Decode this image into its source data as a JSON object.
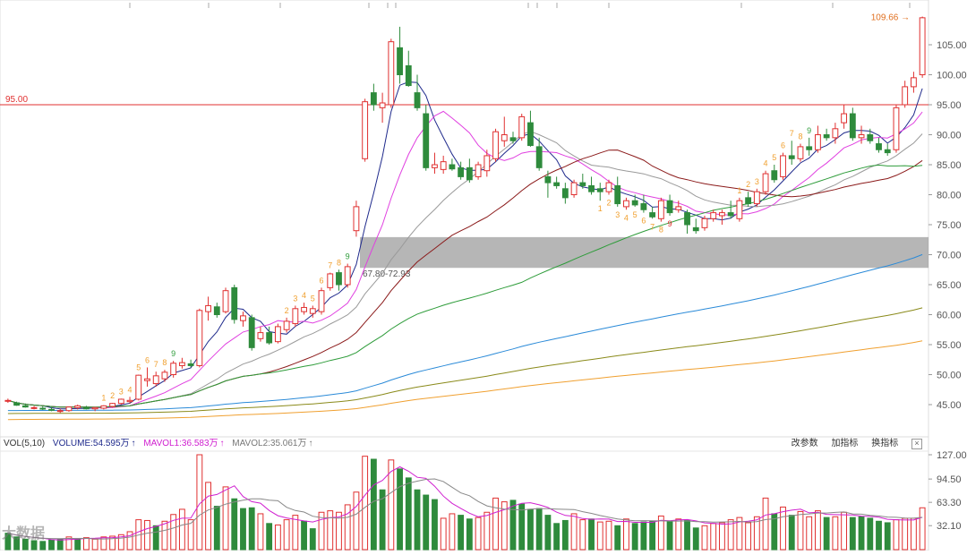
{
  "price_axis": {
    "ticks": [
      {
        "label": "105.00",
        "value": 105
      },
      {
        "label": "100.00",
        "value": 100
      },
      {
        "label": "95.00",
        "value": 95
      },
      {
        "label": "90.00",
        "value": 90
      },
      {
        "label": "85.00",
        "value": 85
      },
      {
        "label": "80.00",
        "value": 80
      },
      {
        "label": "75.00",
        "value": 75
      },
      {
        "label": "70.00",
        "value": 70
      },
      {
        "label": "65.00",
        "value": 65
      },
      {
        "label": "60.00",
        "value": 60
      },
      {
        "label": "55.00",
        "value": 55
      },
      {
        "label": "50.00",
        "value": 50
      },
      {
        "label": "45.00",
        "value": 45
      }
    ]
  },
  "volume_axis": {
    "ticks": [
      {
        "label": "127.00",
        "value": 127
      },
      {
        "label": "94.50",
        "value": 94.5
      },
      {
        "label": "63.30",
        "value": 63.3
      },
      {
        "label": "32.10",
        "value": 32.1
      }
    ]
  },
  "reference_line": {
    "label": "95.00",
    "value": 95,
    "color": "#e03030"
  },
  "max_label": "109.66",
  "zone": {
    "label": "67.80-72.93",
    "low": 67.8,
    "high": 72.93
  },
  "volume_header": {
    "title": "VOL(5,10)",
    "volume": "VOLUME:54.595万",
    "mavol1": "MAVOL1:36.583万",
    "mavol2": "MAVOL2:35.061万",
    "arrow": "↑",
    "btn_params": "改参数",
    "btn_add": "加指标",
    "btn_switch": "换指标",
    "btn_close": "×"
  },
  "watermark": "大数据",
  "colors": {
    "up": "#e03030",
    "down": "#2e8b3c",
    "ma5": "#1f2a8c",
    "ma10": "#e040e0",
    "ma20": "#9a9a9a",
    "ma30": "#8b1a1a",
    "ma60": "#2e9c3a",
    "ma120": "#2a8ad8",
    "ma180": "#8a8a1a",
    "ma250": "#f0a030",
    "td_sequence": "#f0a030",
    "td_sequence_9": "#2e9c3a"
  },
  "chart_data": {
    "type": "candlestick",
    "ylim": [
      43,
      111
    ],
    "candles": [
      [
        45.6,
        46.0,
        45.3,
        45.7
      ],
      [
        45.3,
        45.5,
        44.8,
        44.9
      ],
      [
        44.8,
        45.2,
        44.5,
        44.6
      ],
      [
        44.4,
        44.8,
        44.2,
        44.5
      ],
      [
        44.4,
        44.7,
        44.1,
        44.3
      ],
      [
        44.2,
        44.6,
        43.9,
        44.1
      ],
      [
        43.9,
        44.3,
        43.6,
        44.0
      ],
      [
        44.0,
        44.7,
        43.8,
        44.6
      ],
      [
        44.5,
        45.0,
        44.2,
        44.8
      ],
      [
        44.5,
        44.8,
        44.2,
        44.3
      ],
      [
        44.3,
        44.6,
        43.9,
        44.5
      ],
      [
        44.4,
        44.9,
        44.2,
        44.8
      ],
      [
        44.7,
        45.3,
        44.5,
        45.2
      ],
      [
        45.2,
        46.0,
        45.0,
        45.9
      ],
      [
        45.5,
        46.3,
        45.2,
        45.7
      ],
      [
        45.9,
        50.0,
        45.7,
        49.9
      ],
      [
        49.0,
        51.2,
        48.0,
        49.3
      ],
      [
        48.5,
        50.5,
        48.0,
        49.8
      ],
      [
        49.3,
        50.8,
        48.8,
        50.4
      ],
      [
        50.0,
        52.3,
        49.5,
        51.9
      ],
      [
        51.5,
        52.8,
        51.0,
        52.0
      ],
      [
        51.8,
        52.5,
        51.2,
        51.5
      ],
      [
        51.5,
        61.0,
        51.2,
        60.7
      ],
      [
        60.5,
        63.0,
        59.0,
        61.5
      ],
      [
        61.3,
        62.0,
        59.5,
        60.0
      ],
      [
        60.5,
        64.5,
        60.2,
        64.0
      ],
      [
        64.5,
        65.0,
        58.5,
        59.2
      ],
      [
        59.0,
        60.5,
        58.0,
        59.8
      ],
      [
        59.5,
        60.0,
        54.0,
        54.5
      ],
      [
        56.0,
        58.0,
        55.5,
        57.0
      ],
      [
        57.0,
        58.0,
        55.0,
        55.3
      ],
      [
        55.5,
        58.5,
        55.2,
        58.0
      ],
      [
        57.5,
        59.5,
        57.0,
        58.9
      ],
      [
        58.5,
        61.5,
        58.0,
        61.0
      ],
      [
        60.5,
        62.0,
        60.0,
        61.2
      ],
      [
        60.2,
        61.5,
        59.5,
        61.0
      ],
      [
        60.5,
        64.5,
        60.0,
        64.0
      ],
      [
        64.5,
        67.0,
        64.0,
        66.8
      ],
      [
        67.0,
        67.5,
        64.0,
        65.0
      ],
      [
        65.0,
        68.5,
        64.5,
        68.0
      ],
      [
        74.0,
        79.0,
        73.0,
        78.0
      ],
      [
        86.0,
        96.0,
        85.5,
        95.5
      ],
      [
        97.0,
        98.5,
        94.0,
        95.0
      ],
      [
        94.5,
        97.0,
        92.0,
        95.3
      ],
      [
        95.0,
        106.0,
        94.5,
        105.5
      ],
      [
        104.5,
        108.0,
        98.5,
        100.0
      ],
      [
        101.5,
        104.0,
        98.0,
        98.2
      ],
      [
        97.0,
        100.0,
        94.0,
        94.5
      ],
      [
        93.5,
        95.0,
        84.0,
        84.5
      ],
      [
        84.5,
        87.0,
        83.5,
        85.0
      ],
      [
        84.2,
        86.5,
        83.5,
        85.5
      ],
      [
        85.0,
        86.0,
        84.0,
        84.3
      ],
      [
        84.5,
        85.5,
        82.5,
        83.0
      ],
      [
        84.5,
        86.0,
        82.0,
        82.5
      ],
      [
        83.0,
        85.5,
        82.5,
        85.0
      ],
      [
        84.0,
        87.5,
        83.0,
        86.5
      ],
      [
        86.0,
        91.0,
        85.5,
        90.5
      ],
      [
        89.0,
        93.0,
        88.0,
        90.0
      ],
      [
        89.5,
        90.5,
        88.5,
        89.0
      ],
      [
        89.5,
        93.5,
        89.0,
        93.0
      ],
      [
        92.0,
        94.0,
        88.0,
        88.2
      ],
      [
        88.0,
        89.5,
        84.0,
        84.5
      ],
      [
        83.0,
        84.0,
        79.5,
        82.0
      ],
      [
        82.0,
        83.0,
        81.0,
        81.5
      ],
      [
        81.0,
        82.0,
        78.5,
        79.5
      ],
      [
        80.0,
        82.5,
        79.5,
        82.0
      ],
      [
        82.0,
        83.5,
        81.0,
        81.5
      ],
      [
        81.5,
        83.0,
        80.0,
        80.5
      ],
      [
        81.0,
        82.0,
        79.0,
        80.5
      ],
      [
        80.5,
        82.5,
        80.0,
        82.0
      ],
      [
        81.5,
        83.0,
        78.0,
        78.5
      ],
      [
        78.0,
        79.5,
        77.5,
        79.0
      ],
      [
        79.0,
        80.0,
        78.0,
        78.3
      ],
      [
        78.5,
        80.0,
        77.0,
        77.5
      ],
      [
        77.0,
        78.0,
        76.0,
        76.3
      ],
      [
        76.0,
        79.5,
        75.5,
        79.0
      ],
      [
        79.0,
        80.0,
        76.5,
        77.0
      ],
      [
        77.5,
        79.0,
        77.0,
        78.0
      ],
      [
        77.0,
        77.5,
        73.5,
        75.0
      ],
      [
        74.5,
        76.0,
        73.5,
        74.0
      ],
      [
        74.5,
        76.5,
        74.0,
        76.0
      ],
      [
        76.0,
        77.5,
        75.5,
        77.0
      ],
      [
        76.5,
        77.5,
        75.0,
        77.0
      ],
      [
        77.0,
        79.0,
        76.0,
        76.5
      ],
      [
        76.0,
        79.5,
        75.5,
        79.0
      ],
      [
        79.5,
        80.5,
        78.0,
        78.5
      ],
      [
        78.5,
        81.0,
        78.0,
        80.5
      ],
      [
        80.5,
        84.0,
        80.0,
        83.5
      ],
      [
        84.0,
        85.0,
        82.0,
        82.5
      ],
      [
        83.0,
        87.0,
        82.5,
        86.5
      ],
      [
        86.5,
        89.0,
        85.0,
        86.0
      ],
      [
        86.0,
        88.5,
        85.5,
        88.0
      ],
      [
        88.0,
        89.5,
        86.5,
        87.5
      ],
      [
        87.5,
        91.5,
        87.0,
        90.0
      ],
      [
        90.0,
        91.0,
        89.0,
        89.5
      ],
      [
        89.5,
        92.0,
        88.5,
        91.0
      ],
      [
        92.0,
        95.0,
        91.0,
        93.5
      ],
      [
        93.5,
        94.5,
        89.0,
        89.5
      ],
      [
        89.5,
        91.5,
        88.5,
        90.0
      ],
      [
        90.0,
        91.0,
        88.5,
        89.0
      ],
      [
        88.5,
        89.5,
        87.0,
        87.5
      ],
      [
        87.5,
        88.5,
        86.5,
        87.0
      ],
      [
        87.5,
        95.0,
        87.0,
        94.5
      ],
      [
        95.0,
        99.0,
        94.5,
        98.0
      ],
      [
        98.0,
        100.5,
        97.0,
        99.5
      ],
      [
        100.0,
        109.7,
        99.5,
        109.5
      ]
    ],
    "volumes": [
      [
        22,
        "down"
      ],
      [
        17,
        "down"
      ],
      [
        14,
        "down"
      ],
      [
        12,
        "down"
      ],
      [
        11,
        "down"
      ],
      [
        13,
        "down"
      ],
      [
        14,
        "down"
      ],
      [
        17,
        "up"
      ],
      [
        15,
        "down"
      ],
      [
        16,
        "up"
      ],
      [
        14,
        "up"
      ],
      [
        17,
        "up"
      ],
      [
        18,
        "up"
      ],
      [
        20,
        "up"
      ],
      [
        24,
        "up"
      ],
      [
        40,
        "up"
      ],
      [
        39,
        "up"
      ],
      [
        32,
        "down"
      ],
      [
        38,
        "up"
      ],
      [
        47,
        "up"
      ],
      [
        54,
        "up"
      ],
      [
        40,
        "up"
      ],
      [
        127,
        "up"
      ],
      [
        90,
        "up"
      ],
      [
        58,
        "down"
      ],
      [
        84,
        "up"
      ],
      [
        68,
        "down"
      ],
      [
        55,
        "down"
      ],
      [
        56,
        "down"
      ],
      [
        48,
        "up"
      ],
      [
        35,
        "down"
      ],
      [
        33,
        "up"
      ],
      [
        40,
        "up"
      ],
      [
        46,
        "up"
      ],
      [
        38,
        "down"
      ],
      [
        28,
        "down"
      ],
      [
        50,
        "up"
      ],
      [
        52,
        "up"
      ],
      [
        50,
        "up"
      ],
      [
        60,
        "up"
      ],
      [
        77,
        "up"
      ],
      [
        125,
        "up"
      ],
      [
        121,
        "down"
      ],
      [
        80,
        "down"
      ],
      [
        120,
        "up"
      ],
      [
        108,
        "down"
      ],
      [
        96,
        "down"
      ],
      [
        80,
        "down"
      ],
      [
        73,
        "down"
      ],
      [
        67,
        "down"
      ],
      [
        42,
        "up"
      ],
      [
        48,
        "up"
      ],
      [
        46,
        "down"
      ],
      [
        41,
        "down"
      ],
      [
        43,
        "up"
      ],
      [
        50,
        "up"
      ],
      [
        69,
        "up"
      ],
      [
        64,
        "up"
      ],
      [
        66,
        "down"
      ],
      [
        61,
        "down"
      ],
      [
        54,
        "down"
      ],
      [
        55,
        "down"
      ],
      [
        46,
        "down"
      ],
      [
        35,
        "down"
      ],
      [
        39,
        "down"
      ],
      [
        48,
        "up"
      ],
      [
        40,
        "up"
      ],
      [
        41,
        "down"
      ],
      [
        37,
        "up"
      ],
      [
        38,
        "up"
      ],
      [
        32,
        "down"
      ],
      [
        41,
        "up"
      ],
      [
        35,
        "down"
      ],
      [
        37,
        "down"
      ],
      [
        38,
        "down"
      ],
      [
        45,
        "up"
      ],
      [
        38,
        "down"
      ],
      [
        41,
        "up"
      ],
      [
        39,
        "down"
      ],
      [
        29,
        "down"
      ],
      [
        32,
        "up"
      ],
      [
        35,
        "up"
      ],
      [
        36,
        "up"
      ],
      [
        40,
        "up"
      ],
      [
        43,
        "up"
      ],
      [
        36,
        "up"
      ],
      [
        44,
        "up"
      ],
      [
        69,
        "up"
      ],
      [
        48,
        "down"
      ],
      [
        57,
        "up"
      ],
      [
        46,
        "down"
      ],
      [
        51,
        "up"
      ],
      [
        44,
        "up"
      ],
      [
        52,
        "up"
      ],
      [
        43,
        "down"
      ],
      [
        44,
        "up"
      ],
      [
        50,
        "up"
      ],
      [
        43,
        "down"
      ],
      [
        44,
        "down"
      ],
      [
        42,
        "down"
      ],
      [
        38,
        "down"
      ],
      [
        36,
        "down"
      ],
      [
        40,
        "up"
      ],
      [
        42,
        "up"
      ],
      [
        42,
        "up"
      ],
      [
        56,
        "up"
      ]
    ],
    "td_labels_up": [
      [
        11,
        "1"
      ],
      [
        12,
        "2"
      ],
      [
        13,
        "3"
      ],
      [
        14,
        "4"
      ],
      [
        15,
        "5"
      ],
      [
        16,
        "6"
      ],
      [
        17,
        "7"
      ],
      [
        18,
        "8"
      ],
      [
        19,
        "9"
      ],
      [
        32,
        "2"
      ],
      [
        33,
        "3"
      ],
      [
        34,
        "4"
      ],
      [
        35,
        "5"
      ],
      [
        36,
        "6"
      ],
      [
        37,
        "7"
      ],
      [
        38,
        "8"
      ],
      [
        39,
        "9"
      ],
      [
        84,
        "1"
      ],
      [
        85,
        "2"
      ],
      [
        86,
        "3"
      ],
      [
        87,
        "4"
      ],
      [
        88,
        "5"
      ],
      [
        89,
        "6"
      ],
      [
        90,
        "7"
      ],
      [
        91,
        "8"
      ],
      [
        92,
        "9"
      ]
    ],
    "td_labels_down": [
      [
        68,
        "1"
      ],
      [
        69,
        "2"
      ],
      [
        70,
        "3"
      ],
      [
        71,
        "4"
      ],
      [
        72,
        "5"
      ],
      [
        73,
        "6"
      ],
      [
        74,
        "7"
      ],
      [
        75,
        "8"
      ],
      [
        76,
        "9"
      ]
    ]
  }
}
